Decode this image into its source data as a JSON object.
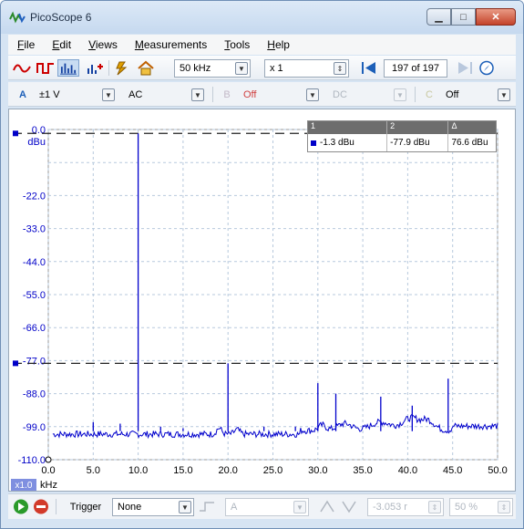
{
  "window": {
    "title": "PicoScope 6"
  },
  "menu": [
    "File",
    "Edit",
    "Views",
    "Measurements",
    "Tools",
    "Help"
  ],
  "menu_underline": [
    "F",
    "E",
    "V",
    "M",
    "T",
    "H"
  ],
  "toolbar": {
    "timebase": "50 kHz",
    "zoom": "x 1",
    "capture_position": "197 of 197"
  },
  "channels": {
    "a_label": "A",
    "a_range": "±1 V",
    "a_coupling": "AC",
    "b_label": "B",
    "b_range": "Off",
    "b_coupling": "DC",
    "c_label": "C",
    "c_range": "Off"
  },
  "measurements": {
    "headers": [
      "1",
      "2",
      "Δ"
    ],
    "values": [
      "-1.3 dBu",
      "-77.9 dBu",
      "76.6 dBu"
    ]
  },
  "axes": {
    "y_unit": "dBu",
    "y_ticks": [
      "0.0",
      "-22.0",
      "-33.0",
      "-44.0",
      "-55.0",
      "-66.0",
      "-77.0",
      "-88.0",
      "-99.0",
      "-110.0"
    ],
    "x_ticks": [
      "0.0",
      "5.0",
      "10.0",
      "15.0",
      "20.0",
      "25.0",
      "30.0",
      "35.0",
      "40.0",
      "45.0",
      "50.0"
    ],
    "x_unit": "kHz",
    "x_zoom": "x1.0"
  },
  "trigger": {
    "label": "Trigger",
    "mode": "None",
    "source": "A",
    "level": "-3.053 r",
    "pretrigger": "50 %"
  },
  "chart_data": {
    "type": "line",
    "x_unit": "kHz",
    "y_unit": "dBu",
    "xlim": [
      0,
      50
    ],
    "ylim": [
      -110,
      0
    ],
    "grid": true,
    "rulers_dBu": [
      -1.3,
      -77.9
    ],
    "noise_floor_dBu": -101.5,
    "peaks": [
      {
        "x": 10.0,
        "y": -1.3
      },
      {
        "x": 20.0,
        "y": -77.9
      },
      {
        "x": 30.0,
        "y": -84.5
      },
      {
        "x": 44.5,
        "y": -83.0
      },
      {
        "x": 32.0,
        "y": -88.0
      },
      {
        "x": 37.0,
        "y": -89.0
      },
      {
        "x": 40.5,
        "y": -92.0
      },
      {
        "x": 5.0,
        "y": -97.5
      },
      {
        "x": 8.0,
        "y": -98.0
      },
      {
        "x": 12.5,
        "y": -99.0
      },
      {
        "x": 15.0,
        "y": -99.5
      },
      {
        "x": 24.0,
        "y": -99.0
      },
      {
        "x": 27.5,
        "y": -99.0
      }
    ],
    "series_color": "#0000cc"
  }
}
